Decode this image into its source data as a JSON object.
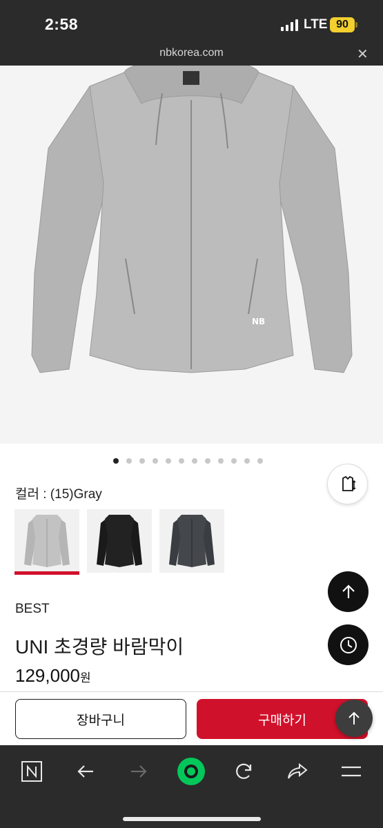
{
  "status": {
    "time": "2:58",
    "network": "LTE",
    "battery": "90"
  },
  "browser": {
    "url": "nbkorea.com",
    "close_glyph": "✕"
  },
  "gallery": {
    "image_count": 12,
    "active_index": 0
  },
  "color": {
    "label": "컬러 : (15)Gray",
    "options": [
      "gray",
      "black",
      "charcoal"
    ],
    "selected": 0
  },
  "product": {
    "badge": "BEST",
    "name": "UNI 초경량 바람막이",
    "price": "129,000",
    "currency": "원"
  },
  "actions": {
    "cart_label": "장바구니",
    "buy_label": "구매하기"
  },
  "floating": [
    "size-guide-icon",
    "scroll-top-icon",
    "recent-history-icon",
    "scroll-top-icon"
  ],
  "browser_nav": [
    "naver-icon",
    "back-icon",
    "forward-icon",
    "green-dot-icon",
    "refresh-icon",
    "share-icon",
    "menu-icon"
  ],
  "colors": {
    "accent": "#d0112b",
    "dark_bar": "#2b2b2b",
    "battery": "#f3cf2f",
    "green": "#03c75a"
  }
}
